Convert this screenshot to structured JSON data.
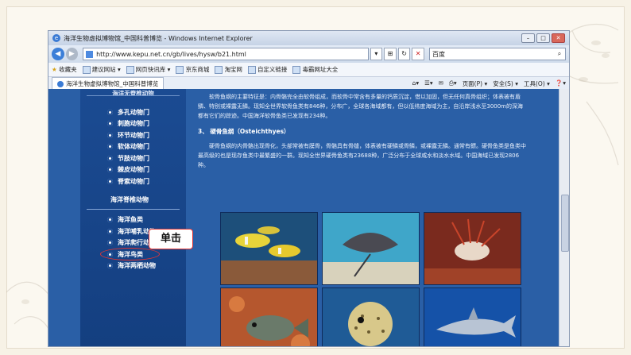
{
  "window": {
    "title": "海洋生物虚拟博物馆_中国科普博览 - Windows Internet Explorer"
  },
  "address": {
    "url": "http://www.kepu.net.cn/gb/lives/hysw/b21.html",
    "search_engine": "百度"
  },
  "favorites_bar": {
    "favorites_label": "收藏夹",
    "items": [
      "建议网站 ▾",
      "网页快讯库 ▾",
      "京东商城",
      "淘宝网",
      "自定义链接",
      "毒霸网址大全"
    ]
  },
  "tab": {
    "label": "海洋生物虚拟博物馆_中国科普博览"
  },
  "toolbar": {
    "page": "页面(P) ▾",
    "safety": "安全(S) ▾",
    "tools": "工具(O) ▾",
    "help": "❓▾"
  },
  "sidebar": {
    "head_top": "海洋无脊椎动物",
    "invertebrates": [
      "多孔动物门",
      "刺胞动物门",
      "环节动物门",
      "软体动物门",
      "节肢动物门",
      "棘皮动物门",
      "脊索动物门"
    ],
    "vertebrates_head": "海洋脊椎动物",
    "vertebrates": [
      "海洋鱼类",
      "海洋哺乳动物",
      "海洋爬行动物",
      "海洋鸟类",
      "海洋两栖动物"
    ]
  },
  "callout": {
    "label": "单击"
  },
  "article": {
    "para1": "软骨鱼纲的主要特征是：内骨骼完全由软骨组成，而软骨中常含有多量的钙质沉淀，借以加固，但无任何真骨组织；体表被有盾鳞、特别或裸露无鳞。现知全世界软骨鱼类有846种，分布广，全球各海域都有，但以低纬度海域为主，自沿岸浅水至3000m的深海都有它们的踪迹。中国海洋软骨鱼类已发现有234种。",
    "section_title": "3、 硬骨鱼纲（Osteichthyes）",
    "para2": "硬骨鱼纲的内骨骼出现骨化，头部常被有膜骨，骨骼具有骨缝，体表被有硬鳞或骨鳞，或裸露无鳞。通常有鳔。硬骨鱼类是鱼类中最高级的也是现存鱼类中最繁盛的一群。现知全世界硬骨鱼类有23688种，广泛分布于全球咸水和淡水水域。中国海域已发现2806种。"
  },
  "photos": [
    "yellow-fish-school",
    "stingray",
    "lionfish",
    "grouper-on-coral",
    "pufferfish",
    "shark"
  ],
  "colors": {
    "page_bg": "#2a5fa6",
    "sidebar_bg": "#1b4b92",
    "highlight": "#e13434"
  }
}
